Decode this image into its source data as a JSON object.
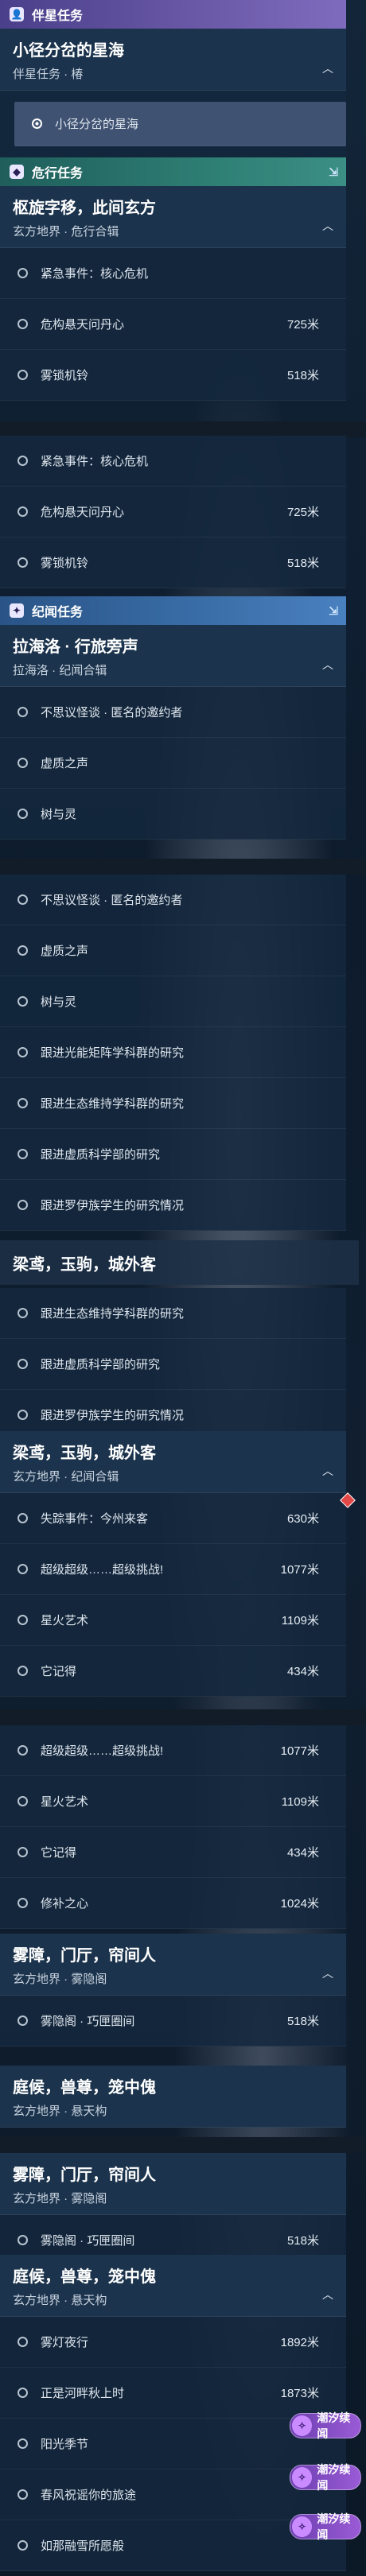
{
  "companion": {
    "category": "伴星任务",
    "quest_title": "小径分岔的星海",
    "quest_sub": "伴星任务 · 椿",
    "selected_step": "小径分岔的星海"
  },
  "danger": {
    "category": "危行任务",
    "quest_title": "枢旋字移，此间玄方",
    "quest_sub": "玄方地界 · 危行合辑",
    "rows": [
      {
        "label": "紧急事件：核心危机",
        "dist": ""
      },
      {
        "label": "危构悬天问丹心",
        "dist": "725米"
      },
      {
        "label": "雾锁机铃",
        "dist": "518米"
      }
    ]
  },
  "chronicle": {
    "category": "纪闻任务",
    "quest_title": "拉海洛 · 行旅旁声",
    "quest_sub": "拉海洛 · 纪闻合辑",
    "rows_a": [
      "不思议怪谈 · 匿名的邀约者",
      "虚质之声",
      "树与灵"
    ],
    "rows_b": [
      "不思议怪谈 · 匿名的邀约者",
      "虚质之声",
      "树与灵",
      "跟进光能矩阵学科群的研究",
      "跟进生态维持学科群的研究",
      "跟进虚质科学部的研究",
      "跟进罗伊族学生的研究情况"
    ],
    "rows_c": [
      "跟进生态维持学科群的研究",
      "跟进虚质科学部的研究",
      "跟进罗伊族学生的研究情况"
    ]
  },
  "liangyi": {
    "title": "梁鸢，玉驹，城外客",
    "sub": "玄方地界 · 纪闻合辑",
    "rows": [
      {
        "label": "失踪事件：今州来客",
        "dist": "630米"
      },
      {
        "label": "超级超级……超级挑战!",
        "dist": "1077米"
      },
      {
        "label": "星火艺术",
        "dist": "1109米"
      },
      {
        "label": "它记得",
        "dist": "434米"
      }
    ],
    "rows2": [
      {
        "label": "超级超级……超级挑战!",
        "dist": "1077米"
      },
      {
        "label": "星火艺术",
        "dist": "1109米"
      },
      {
        "label": "它记得",
        "dist": "434米"
      },
      {
        "label": "修补之心",
        "dist": "1024米"
      }
    ]
  },
  "wuzhang": {
    "title": "雾障，门厅，帘间人",
    "sub": "玄方地界 · 雾隐阁",
    "row": {
      "label": "雾隐阁 · 巧匣圈间",
      "dist": "518米"
    }
  },
  "tinghou": {
    "title": "庭候，兽尊，笼中傀",
    "sub": "玄方地界 · 悬天构",
    "rows": [
      {
        "label": "雾灯夜行",
        "dist": "1892米"
      },
      {
        "label": "正是河畔秋上时",
        "dist": "1873米"
      },
      {
        "label": "阳光季节",
        "dist": ""
      },
      {
        "label": "春风祝谣你的旅途",
        "dist": ""
      },
      {
        "label": "如那融雪所愿般",
        "dist": ""
      }
    ]
  },
  "badges": {
    "label": "潮汐续闻"
  }
}
